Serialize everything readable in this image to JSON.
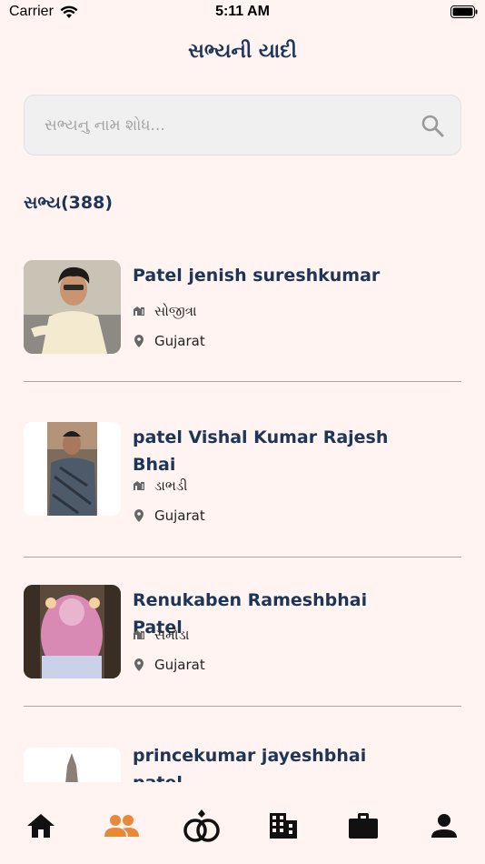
{
  "status_bar": {
    "carrier": "Carrier",
    "time": "5:11 AM"
  },
  "page_title": "સભ્યની યાદી",
  "search": {
    "placeholder": "સભ્યનુ નામ શોધ...",
    "value": ""
  },
  "member_count_label": "સભ્ય(388)",
  "members": [
    {
      "name": "Patel jenish sureshkumar",
      "village": "સોજીત્રા",
      "state": "Gujarat"
    },
    {
      "name": "patel Vishal Kumar Rajesh Bhai",
      "village": "ડાભડી",
      "state": "Gujarat"
    },
    {
      "name": "Renukaben Rameshbhai Patel",
      "village": "સમોડા",
      "state": "Gujarat"
    },
    {
      "name": "princekumar jayeshbhai patel",
      "village": "",
      "state": ""
    }
  ],
  "tab_bar": {
    "active_tab": "members",
    "colors": {
      "active": "#e8893a",
      "inactive": "#111111"
    },
    "tabs": [
      "home-icon",
      "members-icon",
      "rings-icon",
      "building-icon",
      "briefcase-icon",
      "profile-icon"
    ]
  }
}
